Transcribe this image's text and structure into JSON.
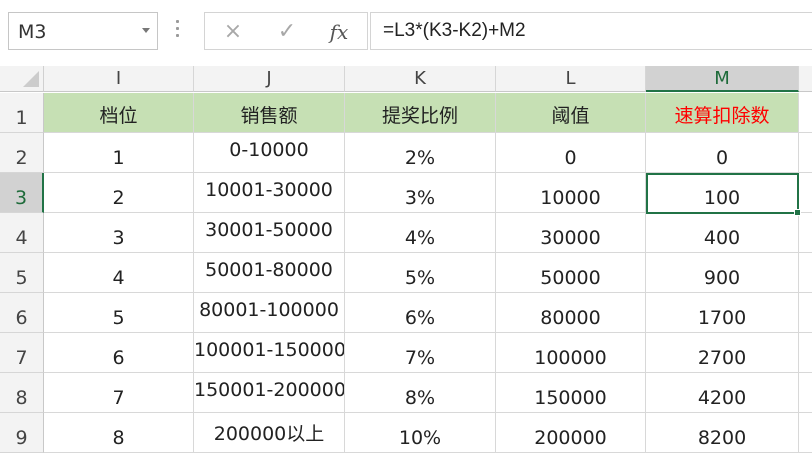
{
  "name_box": "M3",
  "formula": "=L3*(K3-K2)+M2",
  "icons": {
    "cancel": "×",
    "confirm": "✓",
    "function": "fx"
  },
  "columns": [
    "I",
    "J",
    "K",
    "L",
    "M"
  ],
  "selected_column": "M",
  "selected_row": "3",
  "row_numbers": [
    "1",
    "2",
    "3",
    "4",
    "5",
    "6",
    "7",
    "8",
    "9"
  ],
  "headers": [
    "档位",
    "销售额",
    "提奖比例",
    "阈值",
    "速算扣除数"
  ],
  "rows": [
    [
      "1",
      "0-10000",
      "2%",
      "0",
      "0"
    ],
    [
      "2",
      "10001-30000",
      "3%",
      "10000",
      "100"
    ],
    [
      "3",
      "30001-50000",
      "4%",
      "30000",
      "400"
    ],
    [
      "4",
      "50001-80000",
      "5%",
      "50000",
      "900"
    ],
    [
      "5",
      "80001-100000",
      "6%",
      "80000",
      "1700"
    ],
    [
      "6",
      "100001-150000",
      "7%",
      "100000",
      "2700"
    ],
    [
      "7",
      "150001-200000",
      "8%",
      "150000",
      "4200"
    ],
    [
      "8",
      "200000以上",
      "10%",
      "200000",
      "8200"
    ]
  ],
  "colors": {
    "header_fill": "#c6e0b4",
    "accent": "#217346",
    "red_header": "#ff0000"
  }
}
